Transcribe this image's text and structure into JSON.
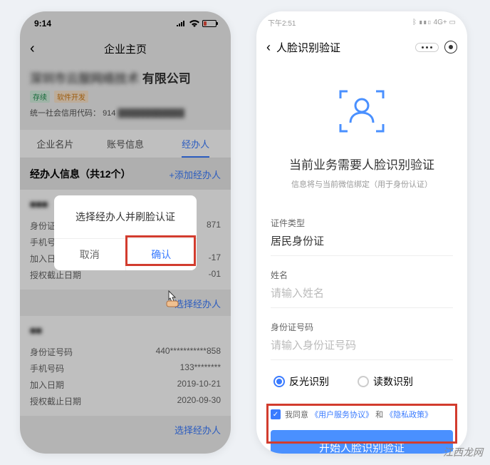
{
  "left": {
    "time": "9:14",
    "nav_title": "企业主页",
    "company_name_blur": "深圳市云服网络技术",
    "company_name_suffix": "有限公司",
    "tag1": "存续",
    "tag2": "软件开发",
    "credit_label": "统一社会信用代码：",
    "credit_value_prefix": "914",
    "tabs": {
      "t1": "企业名片",
      "t2": "账号信息",
      "t3": "经办人"
    },
    "section_title": "经办人信息（共12个）",
    "add_link": "+添加经办人",
    "fields": {
      "id": "身份证号码",
      "phone": "手机号码",
      "join": "加入日期",
      "auth": "授权截止日期"
    },
    "card1": {
      "name": "■■■",
      "id_v": "871",
      "phone_v": "",
      "join_v": "-17",
      "auth_v": "-01"
    },
    "card2": {
      "name": "■■",
      "id_v": "440***********858",
      "phone_v": "133********",
      "join_v": "2019-10-21",
      "auth_v": "2020-09-30"
    },
    "select_link": "选择经办人",
    "dialog": {
      "title": "选择经办人并刷脸认证",
      "cancel": "取消",
      "ok": "确认"
    }
  },
  "right": {
    "time": "下午2:51",
    "signal": "4G+",
    "nav_title": "人脸识别验证",
    "heading": "当前业务需要人脸识别验证",
    "sub": "信息将与当前微信绑定（用于身份认证）",
    "id_type_label": "证件类型",
    "id_type_value": "居民身份证",
    "name_label": "姓名",
    "name_ph": "请输入姓名",
    "idno_label": "身份证号码",
    "idno_ph": "请输入身份证号码",
    "radio1": "反光识别",
    "radio2": "读数识别",
    "agree_pre": "我同意",
    "agree_l1": "《用户服务协议》",
    "agree_mid": "和",
    "agree_l2": "《隐私政策》",
    "start": "开始人脸识别验证"
  },
  "watermark": "江西龙网"
}
